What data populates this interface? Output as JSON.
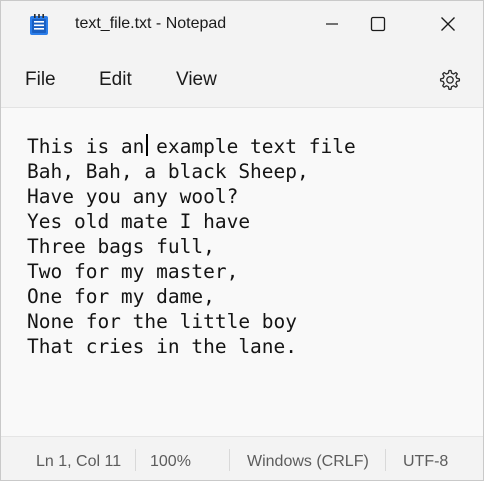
{
  "window": {
    "title": "text_file.txt - Notepad",
    "app_icon": "notepad-icon",
    "controls": [
      "minimize-icon",
      "maximize-icon",
      "close-icon"
    ]
  },
  "menu": {
    "file": "File",
    "edit": "Edit",
    "view": "View",
    "settings_icon": "gear-icon"
  },
  "editor": {
    "lines": [
      "This is an example text file",
      "Bah, Bah, a black Sheep,",
      "Have you any wool?",
      "Yes old mate I have",
      "Three bags full,",
      "Two for my master,",
      "One for my dame,",
      "None for the little boy",
      "That cries in the lane."
    ]
  },
  "status": {
    "position": "Ln 1, Col 11",
    "zoom": "100%",
    "line_endings": "Windows (CRLF)",
    "encoding": "UTF-8"
  },
  "colors": {
    "chrome_bg": "#f3f3f3",
    "editor_bg": "#f9f9f9",
    "icon_blue": "#1f6fd1"
  }
}
